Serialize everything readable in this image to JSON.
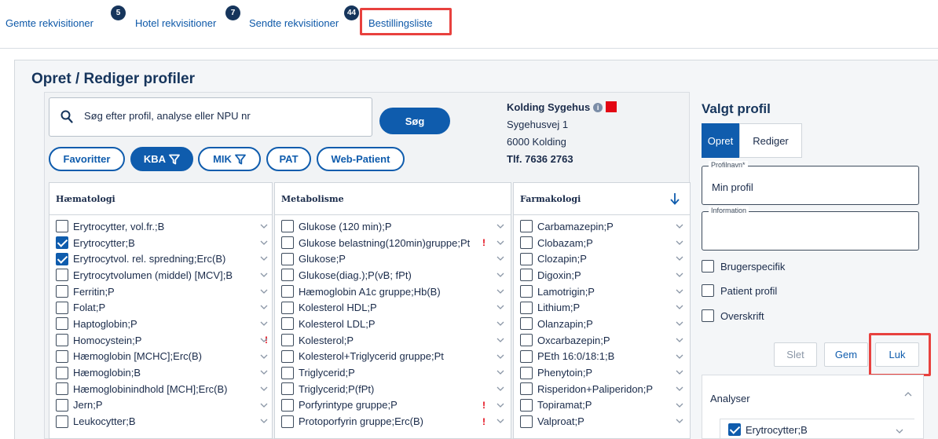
{
  "nav": {
    "tabs": [
      {
        "label": "Gemte rekvisitioner",
        "badge": "5"
      },
      {
        "label": "Hotel rekvisitioner",
        "badge": "7"
      },
      {
        "label": "Sendte rekvisitioner",
        "badge": "44"
      },
      {
        "label": "Bestillingsliste",
        "badge": ""
      }
    ]
  },
  "page": {
    "title": "Opret / Rediger profiler"
  },
  "search": {
    "placeholder": "Søg efter profil, analyse eller NPU nr",
    "button": "Søg"
  },
  "filters": [
    "Favoritter",
    "KBA",
    "MIK",
    "PAT",
    "Web-Patient"
  ],
  "hospital": {
    "name": "Kolding Sygehus",
    "street": "Sygehusvej 1",
    "city": "6000 Kolding",
    "phone": "Tlf. 7636 2763",
    "status_color": "#e30613"
  },
  "columns": [
    {
      "title": "Hæmatologi",
      "items": [
        {
          "label": "Erytrocytter, vol.fr.;B",
          "checked": false,
          "flag": false
        },
        {
          "label": "Erytrocytter;B",
          "checked": true,
          "flag": false
        },
        {
          "label": "Erytrocytvol. rel. spredning;Erc(B)",
          "checked": true,
          "flag": false
        },
        {
          "label": "Erytrocytvolumen (middel) [MCV];B",
          "checked": false,
          "flag": false
        },
        {
          "label": "Ferritin;P",
          "checked": false,
          "flag": false
        },
        {
          "label": "Folat;P",
          "checked": false,
          "flag": false
        },
        {
          "label": "Haptoglobin;P",
          "checked": false,
          "flag": false
        },
        {
          "label": "Homocystein;P",
          "checked": false,
          "flag": true
        },
        {
          "label": "Hæmoglobin [MCHC];Erc(B)",
          "checked": false,
          "flag": false
        },
        {
          "label": "Hæmoglobin;B",
          "checked": false,
          "flag": false
        },
        {
          "label": "Hæmoglobinindhold [MCH];Erc(B)",
          "checked": false,
          "flag": false
        },
        {
          "label": "Jern;P",
          "checked": false,
          "flag": false
        },
        {
          "label": "Leukocytter;B",
          "checked": false,
          "flag": false
        }
      ]
    },
    {
      "title": "Metabolisme",
      "items": [
        {
          "label": "Glukose (120 min);P",
          "checked": false,
          "flag": false
        },
        {
          "label": "Glukose belastning(120min)gruppe;Pt",
          "checked": false,
          "flag": true
        },
        {
          "label": "Glukose;P",
          "checked": false,
          "flag": false
        },
        {
          "label": "Glukose(diag.);P(vB; fPt)",
          "checked": false,
          "flag": false
        },
        {
          "label": "Hæmoglobin A1c gruppe;Hb(B)",
          "checked": false,
          "flag": false
        },
        {
          "label": "Kolesterol HDL;P",
          "checked": false,
          "flag": false
        },
        {
          "label": "Kolesterol LDL;P",
          "checked": false,
          "flag": false
        },
        {
          "label": "Kolesterol;P",
          "checked": false,
          "flag": false
        },
        {
          "label": "Kolesterol+Triglycerid gruppe;Pt",
          "checked": false,
          "flag": false
        },
        {
          "label": "Triglycerid;P",
          "checked": false,
          "flag": false
        },
        {
          "label": "Triglycerid;P(fPt)",
          "checked": false,
          "flag": false
        },
        {
          "label": "Porfyrintype gruppe;P",
          "checked": false,
          "flag": true
        },
        {
          "label": "Protoporfyrin gruppe;Erc(B)",
          "checked": false,
          "flag": true
        }
      ]
    },
    {
      "title": "Farmakologi",
      "items": [
        {
          "label": "Carbamazepin;P",
          "checked": false,
          "flag": false
        },
        {
          "label": "Clobazam;P",
          "checked": false,
          "flag": false
        },
        {
          "label": "Clozapin;P",
          "checked": false,
          "flag": false
        },
        {
          "label": "Digoxin;P",
          "checked": false,
          "flag": false
        },
        {
          "label": "Lamotrigin;P",
          "checked": false,
          "flag": false
        },
        {
          "label": "Lithium;P",
          "checked": false,
          "flag": false
        },
        {
          "label": "Olanzapin;P",
          "checked": false,
          "flag": false
        },
        {
          "label": "Oxcarbazepin;P",
          "checked": false,
          "flag": false
        },
        {
          "label": "PEth 16:0/18:1;B",
          "checked": false,
          "flag": false
        },
        {
          "label": "Phenytoin;P",
          "checked": false,
          "flag": false
        },
        {
          "label": "Risperidon+Paliperidon;P",
          "checked": false,
          "flag": false
        },
        {
          "label": "Topiramat;P",
          "checked": false,
          "flag": false
        },
        {
          "label": "Valproat;P",
          "checked": false,
          "flag": false
        }
      ]
    }
  ],
  "right": {
    "title": "Valgt profil",
    "tab_create": "Opret",
    "tab_edit": "Rediger",
    "profile_name_label": "Profilnavn*",
    "profile_name": "Min profil",
    "information_label": "Information",
    "options": [
      "Brugerspecifik",
      "Patient profil",
      "Overskrift"
    ],
    "btn_delete": "Slet",
    "btn_save": "Gem",
    "btn_close": "Luk",
    "analyses_title": "Analyser",
    "analyses_item": "Erytrocytter;B"
  },
  "colors": {
    "accent": "#0f5cad",
    "navy": "#16355c",
    "highlight": "#e8413e",
    "flag": "#e30613"
  }
}
